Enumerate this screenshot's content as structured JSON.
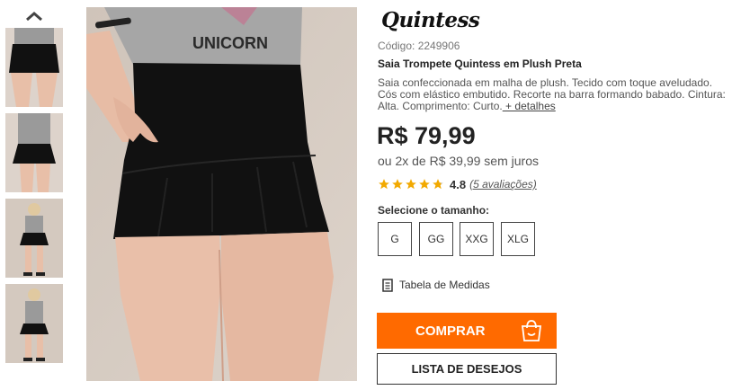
{
  "product": {
    "brand": "Quintess",
    "code": "Código: 2249906",
    "title": "Saia Trompete Quintess em Plush Preta",
    "description": "Saia confeccionada em malha de plush. Tecido com toque aveludado. Cós com elástico embutido. Recorte na barra formando babado. Cintura: Alta. Comprimento: Curto.",
    "more_details_label": " + detalhes",
    "shirt_print": "UNICORN",
    "price": "R$ 79,99",
    "installments": "ou 2x de R$ 39,99 sem juros",
    "rating": {
      "value": "4.8",
      "stars": 4.8,
      "reviews_label": "(5 avaliações)"
    }
  },
  "sizes": {
    "label": "Selecione o tamanho:",
    "options": [
      "G",
      "GG",
      "XXG",
      "XLG"
    ]
  },
  "measures_label": "Tabela de Medidas",
  "actions": {
    "buy_label": "COMPRAR",
    "wishlist_label": "LISTA DE DESEJOS"
  },
  "icons": {
    "thumbnails_up": "chevron-up-icon",
    "measures": "document-icon",
    "buy": "shopping-bag-icon",
    "star": "star-icon"
  },
  "colors": {
    "accent": "#ff6a00",
    "star": "#f2a900",
    "skirt": "#111111"
  }
}
